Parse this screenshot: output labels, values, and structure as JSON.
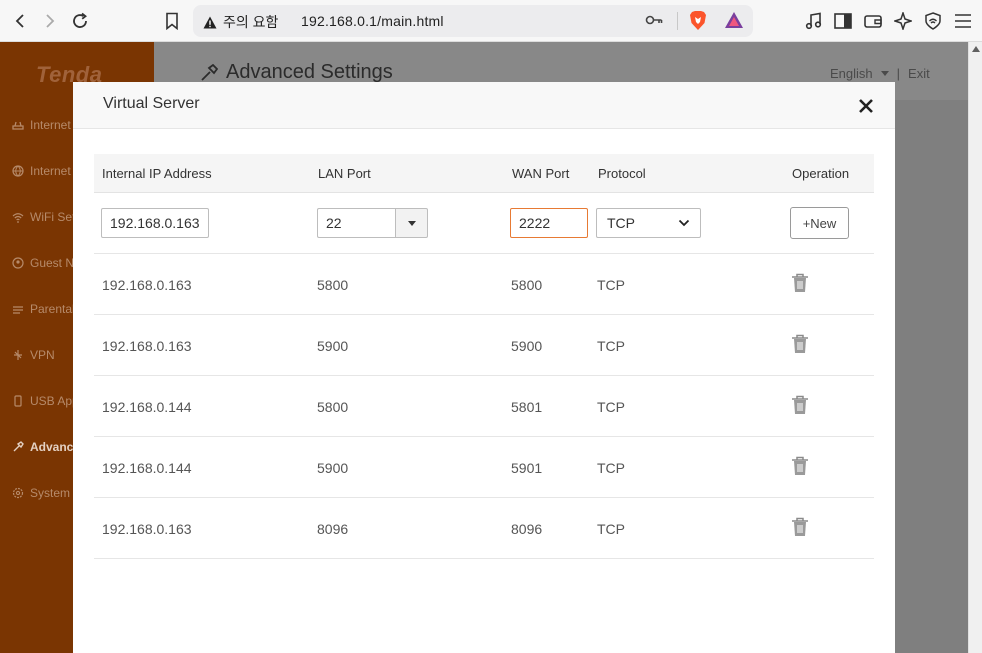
{
  "browser": {
    "security_warning": "주의 요함",
    "url": "192.168.0.1/main.html"
  },
  "app": {
    "logo": "Tenda",
    "page_title": "Advanced Settings",
    "language": "English",
    "exit_label": "Exit",
    "sidebar": [
      {
        "label": "Internet Settings",
        "icon": "globe-icon"
      },
      {
        "label": "Internet Status",
        "icon": "globe-icon"
      },
      {
        "label": "WiFi Settings",
        "icon": "wifi-icon"
      },
      {
        "label": "Guest Network",
        "icon": "guest-icon"
      },
      {
        "label": "Parental Control",
        "icon": "parental-icon"
      },
      {
        "label": "VPN",
        "icon": "vpn-icon"
      },
      {
        "label": "USB Application",
        "icon": "usb-icon"
      },
      {
        "label": "Advanced",
        "icon": "wrench-icon",
        "active": true
      },
      {
        "label": "System",
        "icon": "gear-icon"
      }
    ]
  },
  "modal": {
    "title": "Virtual Server",
    "headers": {
      "ip": "Internal IP Address",
      "lan": "LAN Port",
      "wan": "WAN Port",
      "protocol": "Protocol",
      "operation": "Operation"
    },
    "new_entry": {
      "ip": "192.168.0.163",
      "lan_port": "22",
      "wan_port": "2222",
      "protocol": "TCP",
      "add_label": "+New"
    },
    "rows": [
      {
        "ip": "192.168.0.163",
        "lan": "5800",
        "wan": "5800",
        "protocol": "TCP"
      },
      {
        "ip": "192.168.0.163",
        "lan": "5900",
        "wan": "5900",
        "protocol": "TCP"
      },
      {
        "ip": "192.168.0.144",
        "lan": "5800",
        "wan": "5801",
        "protocol": "TCP"
      },
      {
        "ip": "192.168.0.144",
        "lan": "5900",
        "wan": "5901",
        "protocol": "TCP"
      },
      {
        "ip": "192.168.0.163",
        "lan": "8096",
        "wan": "8096",
        "protocol": "TCP"
      }
    ]
  },
  "colors": {
    "sidebar": "#7a3502",
    "accent": "#e77a34",
    "overlay": "#7f7f7f"
  }
}
